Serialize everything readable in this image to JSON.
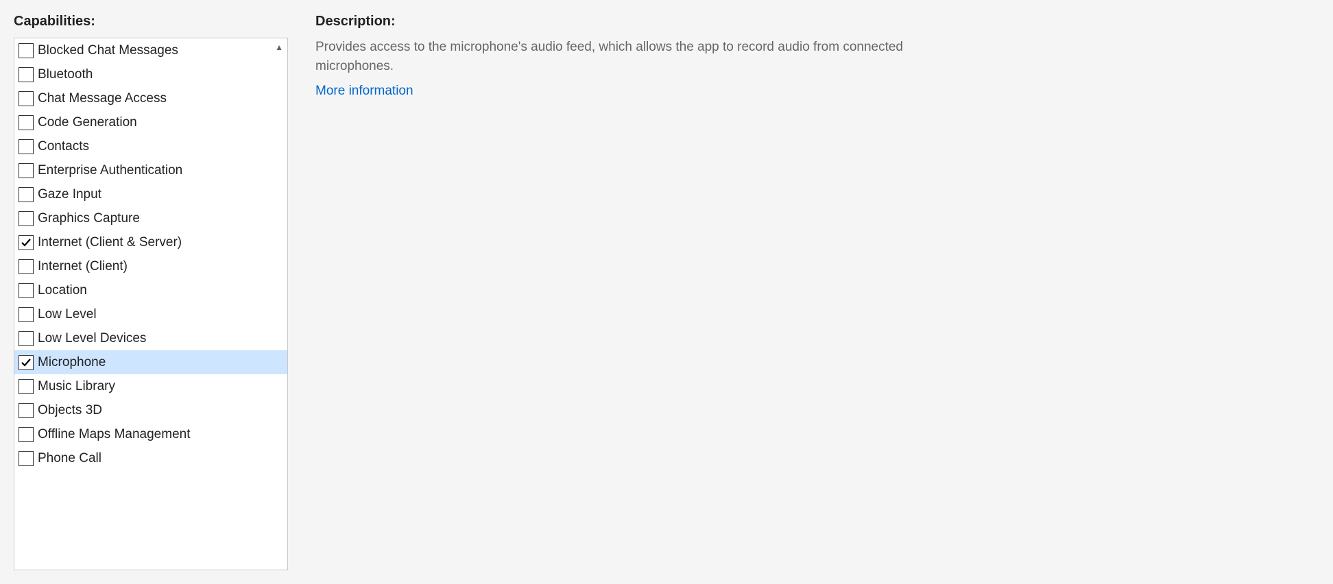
{
  "headings": {
    "capabilities": "Capabilities:",
    "description": "Description:"
  },
  "capabilities": [
    {
      "label": "Blocked Chat Messages",
      "checked": false,
      "selected": false
    },
    {
      "label": "Bluetooth",
      "checked": false,
      "selected": false
    },
    {
      "label": "Chat Message Access",
      "checked": false,
      "selected": false
    },
    {
      "label": "Code Generation",
      "checked": false,
      "selected": false
    },
    {
      "label": "Contacts",
      "checked": false,
      "selected": false
    },
    {
      "label": "Enterprise Authentication",
      "checked": false,
      "selected": false
    },
    {
      "label": "Gaze Input",
      "checked": false,
      "selected": false
    },
    {
      "label": "Graphics Capture",
      "checked": false,
      "selected": false
    },
    {
      "label": "Internet (Client & Server)",
      "checked": true,
      "selected": false
    },
    {
      "label": "Internet (Client)",
      "checked": false,
      "selected": false
    },
    {
      "label": "Location",
      "checked": false,
      "selected": false
    },
    {
      "label": "Low Level",
      "checked": false,
      "selected": false
    },
    {
      "label": "Low Level Devices",
      "checked": false,
      "selected": false
    },
    {
      "label": "Microphone",
      "checked": true,
      "selected": true
    },
    {
      "label": "Music Library",
      "checked": false,
      "selected": false
    },
    {
      "label": "Objects 3D",
      "checked": false,
      "selected": false
    },
    {
      "label": "Offline Maps Management",
      "checked": false,
      "selected": false
    },
    {
      "label": "Phone Call",
      "checked": false,
      "selected": false
    }
  ],
  "description": {
    "text": "Provides access to the microphone's audio feed, which allows the app to record audio from connected microphones.",
    "more_link": "More information"
  }
}
